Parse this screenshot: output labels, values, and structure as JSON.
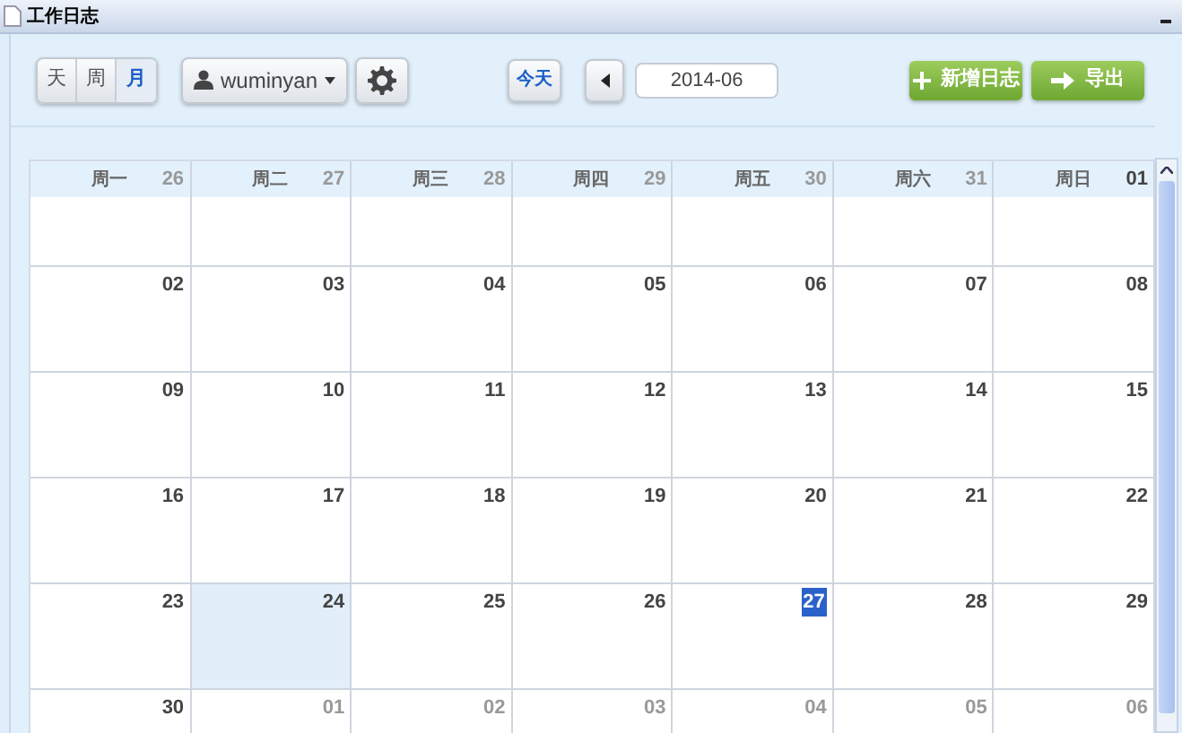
{
  "window": {
    "title": "工作日志"
  },
  "toolbar": {
    "view_buttons": [
      {
        "label": "天",
        "selected": false
      },
      {
        "label": "周",
        "selected": false
      },
      {
        "label": "月",
        "selected": true
      }
    ],
    "user_menu": {
      "label": "wuminyan"
    },
    "today_button": "今天",
    "date_field": {
      "value": "2014-06"
    },
    "actions": [
      {
        "label": "新增日志",
        "kind": "plus"
      },
      {
        "label": "导出",
        "kind": "arrow"
      }
    ]
  },
  "calendar": {
    "weekdays": [
      "周一",
      "周二",
      "周三",
      "周四",
      "周五",
      "周六",
      "周日"
    ],
    "weeks": [
      [
        {
          "day": "26",
          "in_month": false,
          "selected": false,
          "today": false
        },
        {
          "day": "27",
          "in_month": false,
          "selected": false,
          "today": false
        },
        {
          "day": "28",
          "in_month": false,
          "selected": false,
          "today": false
        },
        {
          "day": "29",
          "in_month": false,
          "selected": false,
          "today": false
        },
        {
          "day": "30",
          "in_month": false,
          "selected": false,
          "today": false
        },
        {
          "day": "31",
          "in_month": false,
          "selected": false,
          "today": false
        },
        {
          "day": "01",
          "in_month": true,
          "selected": false,
          "today": false
        }
      ],
      [
        {
          "day": "02",
          "in_month": true,
          "selected": false,
          "today": false
        },
        {
          "day": "03",
          "in_month": true,
          "selected": false,
          "today": false
        },
        {
          "day": "04",
          "in_month": true,
          "selected": false,
          "today": false
        },
        {
          "day": "05",
          "in_month": true,
          "selected": false,
          "today": false
        },
        {
          "day": "06",
          "in_month": true,
          "selected": false,
          "today": false
        },
        {
          "day": "07",
          "in_month": true,
          "selected": false,
          "today": false
        },
        {
          "day": "08",
          "in_month": true,
          "selected": false,
          "today": false
        }
      ],
      [
        {
          "day": "09",
          "in_month": true,
          "selected": false,
          "today": false
        },
        {
          "day": "10",
          "in_month": true,
          "selected": false,
          "today": false
        },
        {
          "day": "11",
          "in_month": true,
          "selected": false,
          "today": false
        },
        {
          "day": "12",
          "in_month": true,
          "selected": false,
          "today": false
        },
        {
          "day": "13",
          "in_month": true,
          "selected": false,
          "today": false
        },
        {
          "day": "14",
          "in_month": true,
          "selected": false,
          "today": false
        },
        {
          "day": "15",
          "in_month": true,
          "selected": false,
          "today": false
        }
      ],
      [
        {
          "day": "16",
          "in_month": true,
          "selected": false,
          "today": false
        },
        {
          "day": "17",
          "in_month": true,
          "selected": false,
          "today": false
        },
        {
          "day": "18",
          "in_month": true,
          "selected": false,
          "today": false
        },
        {
          "day": "19",
          "in_month": true,
          "selected": false,
          "today": false
        },
        {
          "day": "20",
          "in_month": true,
          "selected": false,
          "today": false
        },
        {
          "day": "21",
          "in_month": true,
          "selected": false,
          "today": false
        },
        {
          "day": "22",
          "in_month": true,
          "selected": false,
          "today": false
        }
      ],
      [
        {
          "day": "23",
          "in_month": true,
          "selected": false,
          "today": false
        },
        {
          "day": "24",
          "in_month": true,
          "selected": true,
          "today": false
        },
        {
          "day": "25",
          "in_month": true,
          "selected": false,
          "today": false
        },
        {
          "day": "26",
          "in_month": true,
          "selected": false,
          "today": false
        },
        {
          "day": "27",
          "in_month": true,
          "selected": false,
          "today": true
        },
        {
          "day": "28",
          "in_month": true,
          "selected": false,
          "today": false
        },
        {
          "day": "29",
          "in_month": true,
          "selected": false,
          "today": false
        }
      ],
      [
        {
          "day": "30",
          "in_month": true,
          "selected": false,
          "today": false
        },
        {
          "day": "01",
          "in_month": false,
          "selected": false,
          "today": false
        },
        {
          "day": "02",
          "in_month": false,
          "selected": false,
          "today": false
        },
        {
          "day": "03",
          "in_month": false,
          "selected": false,
          "today": false
        },
        {
          "day": "04",
          "in_month": false,
          "selected": false,
          "today": false
        },
        {
          "day": "05",
          "in_month": false,
          "selected": false,
          "today": false
        },
        {
          "day": "06",
          "in_month": false,
          "selected": false,
          "today": false
        }
      ]
    ]
  }
}
